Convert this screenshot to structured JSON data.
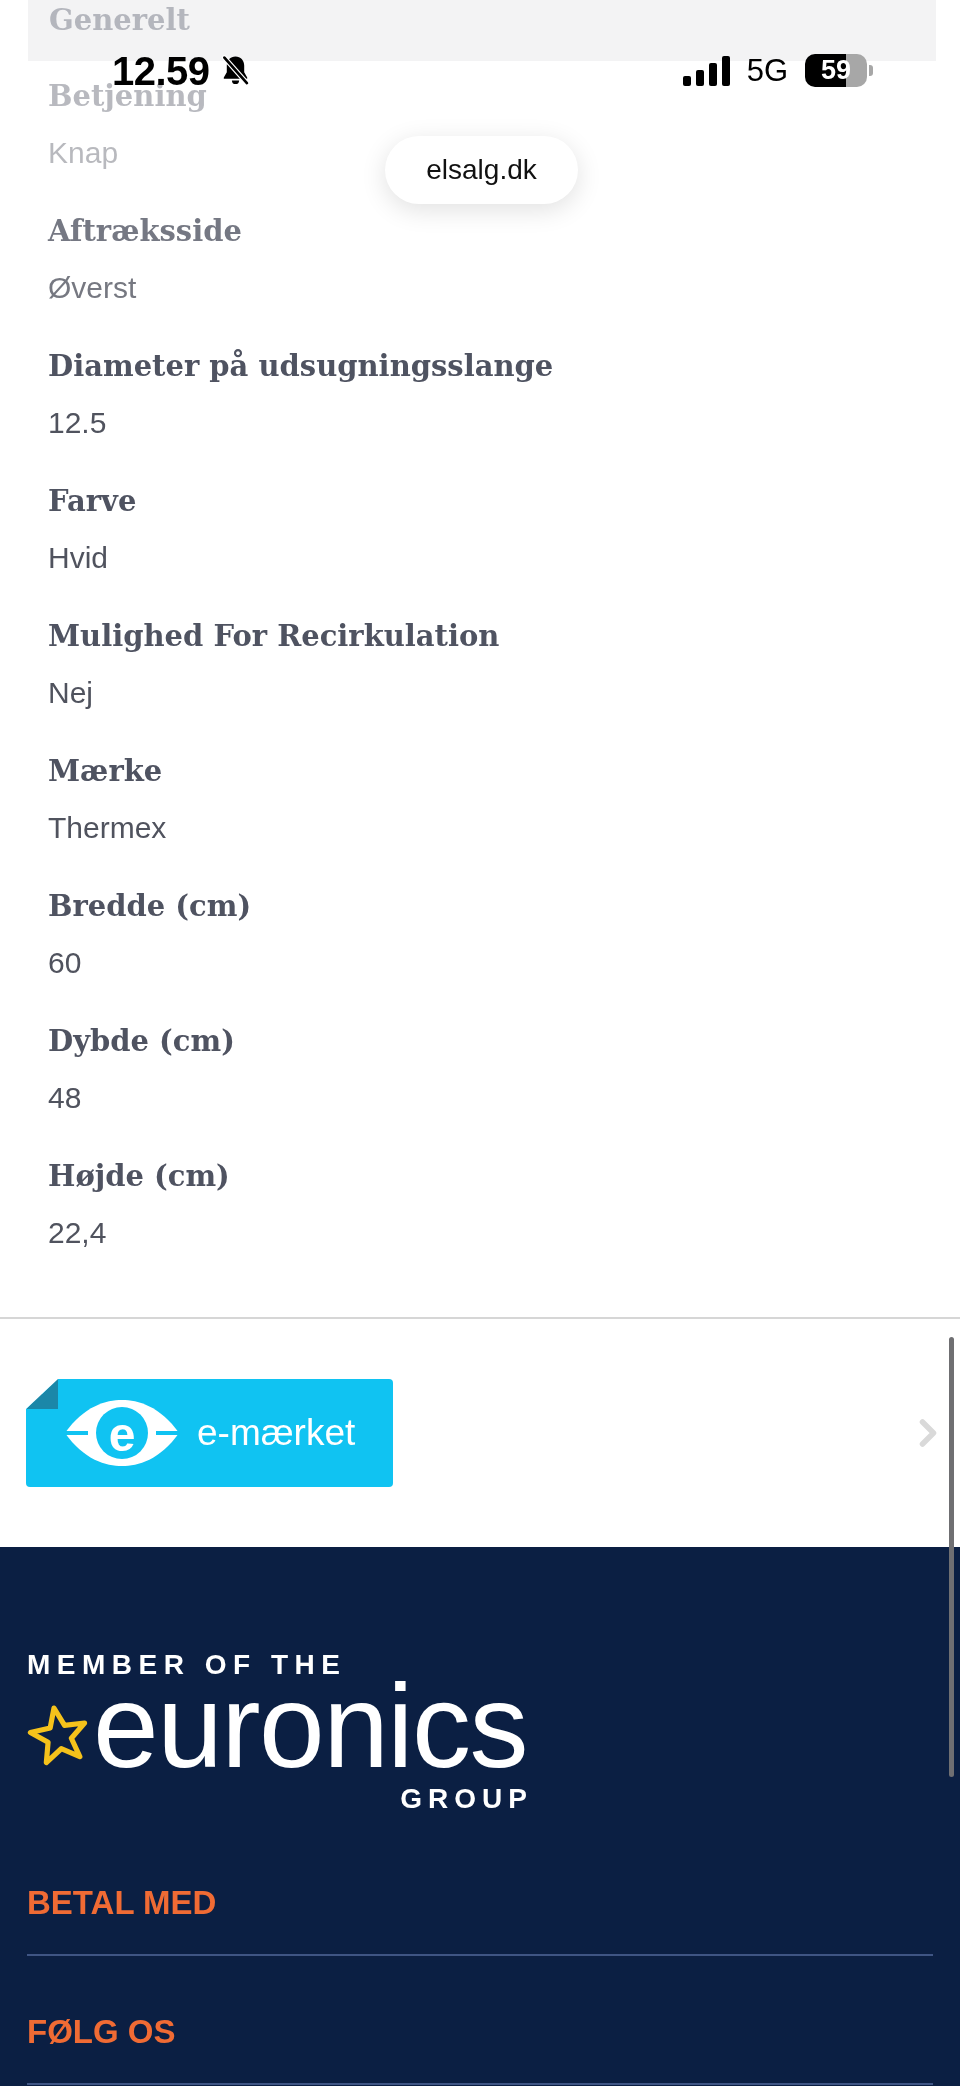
{
  "status_bar": {
    "time": "12.59",
    "network": "5G",
    "battery": "59"
  },
  "address_bar": {
    "url": "elsalg.dk"
  },
  "specifications": {
    "section": "Generelt",
    "items": [
      {
        "label": "Betjening",
        "value": "Knap"
      },
      {
        "label": "Aftræksside",
        "value": "Øverst"
      },
      {
        "label": "Diameter på udsugningsslange",
        "value": "12.5"
      },
      {
        "label": "Farve",
        "value": "Hvid"
      },
      {
        "label": "Mulighed For Recirkulation",
        "value": "Nej"
      },
      {
        "label": "Mærke",
        "value": "Thermex"
      },
      {
        "label": "Bredde (cm)",
        "value": "60"
      },
      {
        "label": "Dybde (cm)",
        "value": "48"
      },
      {
        "label": "Højde (cm)",
        "value": "22,4"
      }
    ]
  },
  "certification": {
    "emblem": "e",
    "label": "e-mærket"
  },
  "footer": {
    "logo": {
      "tagline": "MEMBER OF THE",
      "wordmark": "euronics",
      "subline": "GROUP"
    },
    "sections": [
      {
        "title": "BETAL MED"
      },
      {
        "title": "FØLG OS"
      }
    ]
  }
}
